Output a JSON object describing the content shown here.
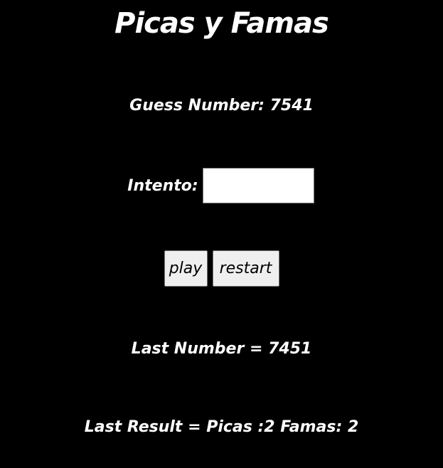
{
  "title": "Picas y Famas",
  "guess_number_text": "Guess Number: 7541",
  "intento": {
    "label": "Intento:",
    "value": ""
  },
  "buttons": {
    "play_label": "play",
    "restart_label": "restart"
  },
  "last_number_text": "Last Number = 7451",
  "last_result_text": "Last Result = Picas :2 Famas: 2",
  "colors": {
    "background": "#000000",
    "text": "#ffffff",
    "button_bg": "#efefef"
  }
}
